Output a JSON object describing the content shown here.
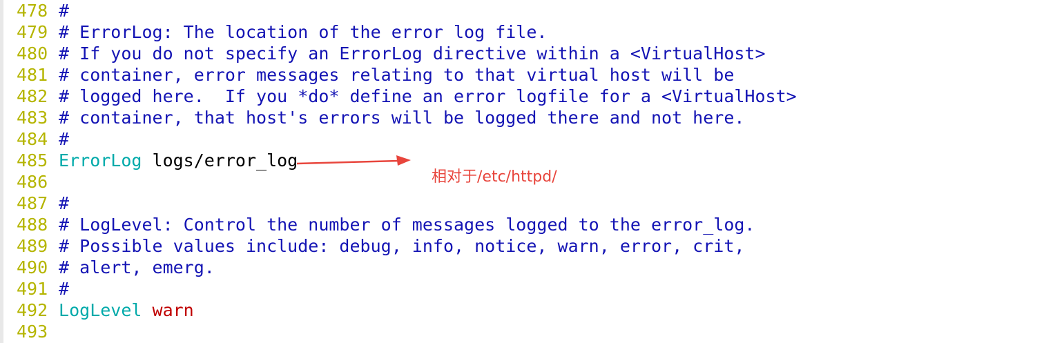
{
  "editor": {
    "lines": [
      {
        "num": "478",
        "segments": [
          {
            "text": " #",
            "kind": "comment"
          }
        ]
      },
      {
        "num": "479",
        "segments": [
          {
            "text": " # ErrorLog: The location of the error log file.",
            "kind": "comment"
          }
        ]
      },
      {
        "num": "480",
        "segments": [
          {
            "text": " # If you do not specify an ErrorLog directive within a <VirtualHost>",
            "kind": "comment"
          }
        ]
      },
      {
        "num": "481",
        "segments": [
          {
            "text": " # container, error messages relating to that virtual host will be",
            "kind": "comment"
          }
        ]
      },
      {
        "num": "482",
        "segments": [
          {
            "text": " # logged here.  If you *do* define an error logfile for a <VirtualHost>",
            "kind": "comment"
          }
        ]
      },
      {
        "num": "483",
        "segments": [
          {
            "text": " # container, that host's errors will be logged there and not here.",
            "kind": "comment"
          }
        ]
      },
      {
        "num": "484",
        "segments": [
          {
            "text": " #",
            "kind": "comment"
          }
        ]
      },
      {
        "num": "485",
        "segments": [
          {
            "text": " ErrorLog",
            "kind": "directive"
          },
          {
            "text": " logs/error_log",
            "kind": "plain"
          }
        ]
      },
      {
        "num": "486",
        "segments": []
      },
      {
        "num": "487",
        "segments": [
          {
            "text": " #",
            "kind": "comment"
          }
        ]
      },
      {
        "num": "488",
        "segments": [
          {
            "text": " # LogLevel: Control the number of messages logged to the error_log.",
            "kind": "comment"
          }
        ]
      },
      {
        "num": "489",
        "segments": [
          {
            "text": " # Possible values include: debug, info, notice, warn, error, crit,",
            "kind": "comment"
          }
        ]
      },
      {
        "num": "490",
        "segments": [
          {
            "text": " # alert, emerg.",
            "kind": "comment"
          }
        ]
      },
      {
        "num": "491",
        "segments": [
          {
            "text": " #",
            "kind": "comment"
          }
        ]
      },
      {
        "num": "492",
        "segments": [
          {
            "text": " LogLevel",
            "kind": "directive"
          },
          {
            "text": " warn",
            "kind": "value-red"
          }
        ]
      },
      {
        "num": "493",
        "segments": []
      }
    ]
  },
  "annotation": {
    "text": "相对于/etc/httpd/",
    "color": "#e8453c"
  },
  "colors": {
    "line_number": "#b5b500",
    "comment": "#1414b4",
    "directive": "#00aaaa",
    "value": "#c00000"
  }
}
